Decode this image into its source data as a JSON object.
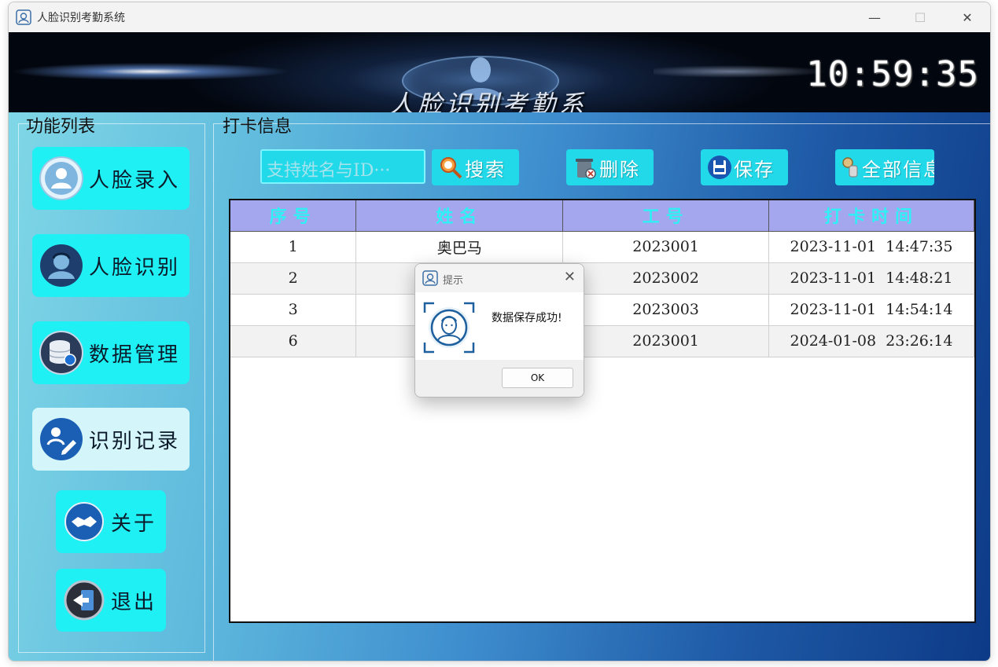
{
  "window": {
    "title": "人脸识别考勤系统",
    "controls": {
      "minimize": "—",
      "maximize": "☐",
      "close": "✕"
    }
  },
  "banner": {
    "title": "人脸识别考勤系",
    "clock": "10:59:35"
  },
  "sidebar": {
    "group_label": "功能列表",
    "items": [
      {
        "label": "人脸录入",
        "icon": "face-enroll-icon"
      },
      {
        "label": "人脸识别",
        "icon": "face-recognition-icon"
      },
      {
        "label": "数据管理",
        "icon": "database-icon"
      },
      {
        "label": "识别记录",
        "icon": "record-edit-icon",
        "active": true
      },
      {
        "label": "关于",
        "icon": "handshake-icon"
      },
      {
        "label": "退出",
        "icon": "exit-icon"
      }
    ]
  },
  "content": {
    "group_label": "打卡信息",
    "search": {
      "placeholder": "支持姓名与ID···"
    },
    "toolbar": {
      "search_label": "搜索",
      "delete_label": "删除",
      "save_label": "保存",
      "all_info_label": "全部信息"
    },
    "table": {
      "headers": [
        "序号",
        "姓名",
        "工号",
        "打卡时间"
      ],
      "rows": [
        {
          "index": "1",
          "name": "奥巴马",
          "id": "2023001",
          "time": "2023-11-01  14:47:35"
        },
        {
          "index": "2",
          "name": "",
          "id": "2023002",
          "time": "2023-11-01  14:48:21"
        },
        {
          "index": "3",
          "name": "",
          "id": "2023003",
          "time": "2023-11-01  14:54:14"
        },
        {
          "index": "6",
          "name": "",
          "id": "2023001",
          "time": "2024-01-08  23:26:14"
        }
      ]
    }
  },
  "dialog": {
    "title": "提示",
    "close": "✕",
    "message": "数据保存成功!",
    "ok_label": "OK"
  },
  "colors": {
    "nav_button": "#1ff0f4",
    "nav_button_active": "#d4f6fa",
    "toolbar_button": "#22d9ea",
    "table_header_bg": "#a4a6ee",
    "table_header_text": "#2ef0f5"
  }
}
